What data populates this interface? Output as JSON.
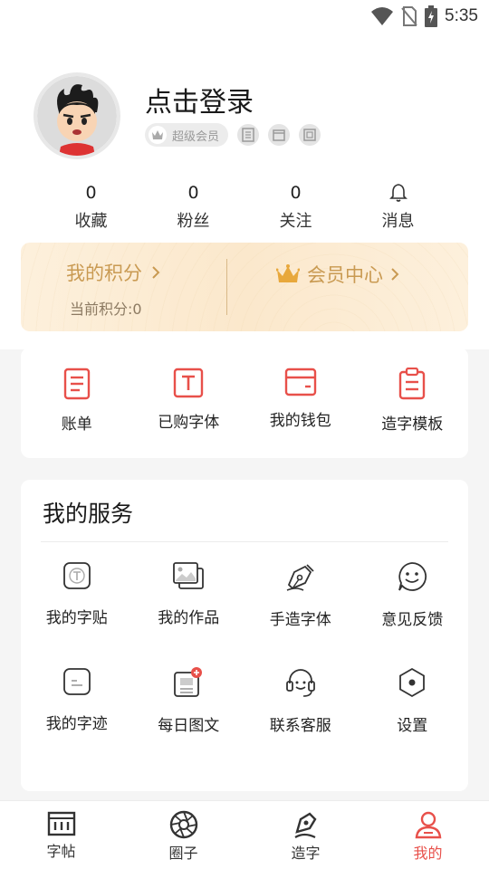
{
  "status_bar": {
    "time": "5:35"
  },
  "profile": {
    "login_text": "点击登录",
    "vip_badge_label": "超级会员"
  },
  "stats": [
    {
      "count": "0",
      "label": "收藏"
    },
    {
      "count": "0",
      "label": "粉丝"
    },
    {
      "count": "0",
      "label": "关注"
    },
    {
      "label": "消息"
    }
  ],
  "points_card": {
    "points_title": "我的积分",
    "points_sub": "当前积分:0",
    "vip_center": "会员中心"
  },
  "tools": [
    {
      "label": "账单"
    },
    {
      "label": "已购字体"
    },
    {
      "label": "我的钱包"
    },
    {
      "label": "造字模板"
    }
  ],
  "services": {
    "title": "我的服务",
    "items": [
      {
        "label": "我的字贴"
      },
      {
        "label": "我的作品"
      },
      {
        "label": "手造字体"
      },
      {
        "label": "意见反馈"
      },
      {
        "label": "我的字迹"
      },
      {
        "label": "每日图文"
      },
      {
        "label": "联系客服"
      },
      {
        "label": "设置"
      }
    ]
  },
  "tabbar": {
    "tabs": [
      {
        "label": "字帖"
      },
      {
        "label": "圈子"
      },
      {
        "label": "造字"
      },
      {
        "label": "我的"
      }
    ],
    "active_color": "#e8504a"
  },
  "colors": {
    "accent": "#e8504a",
    "gold": "#c99a52"
  }
}
